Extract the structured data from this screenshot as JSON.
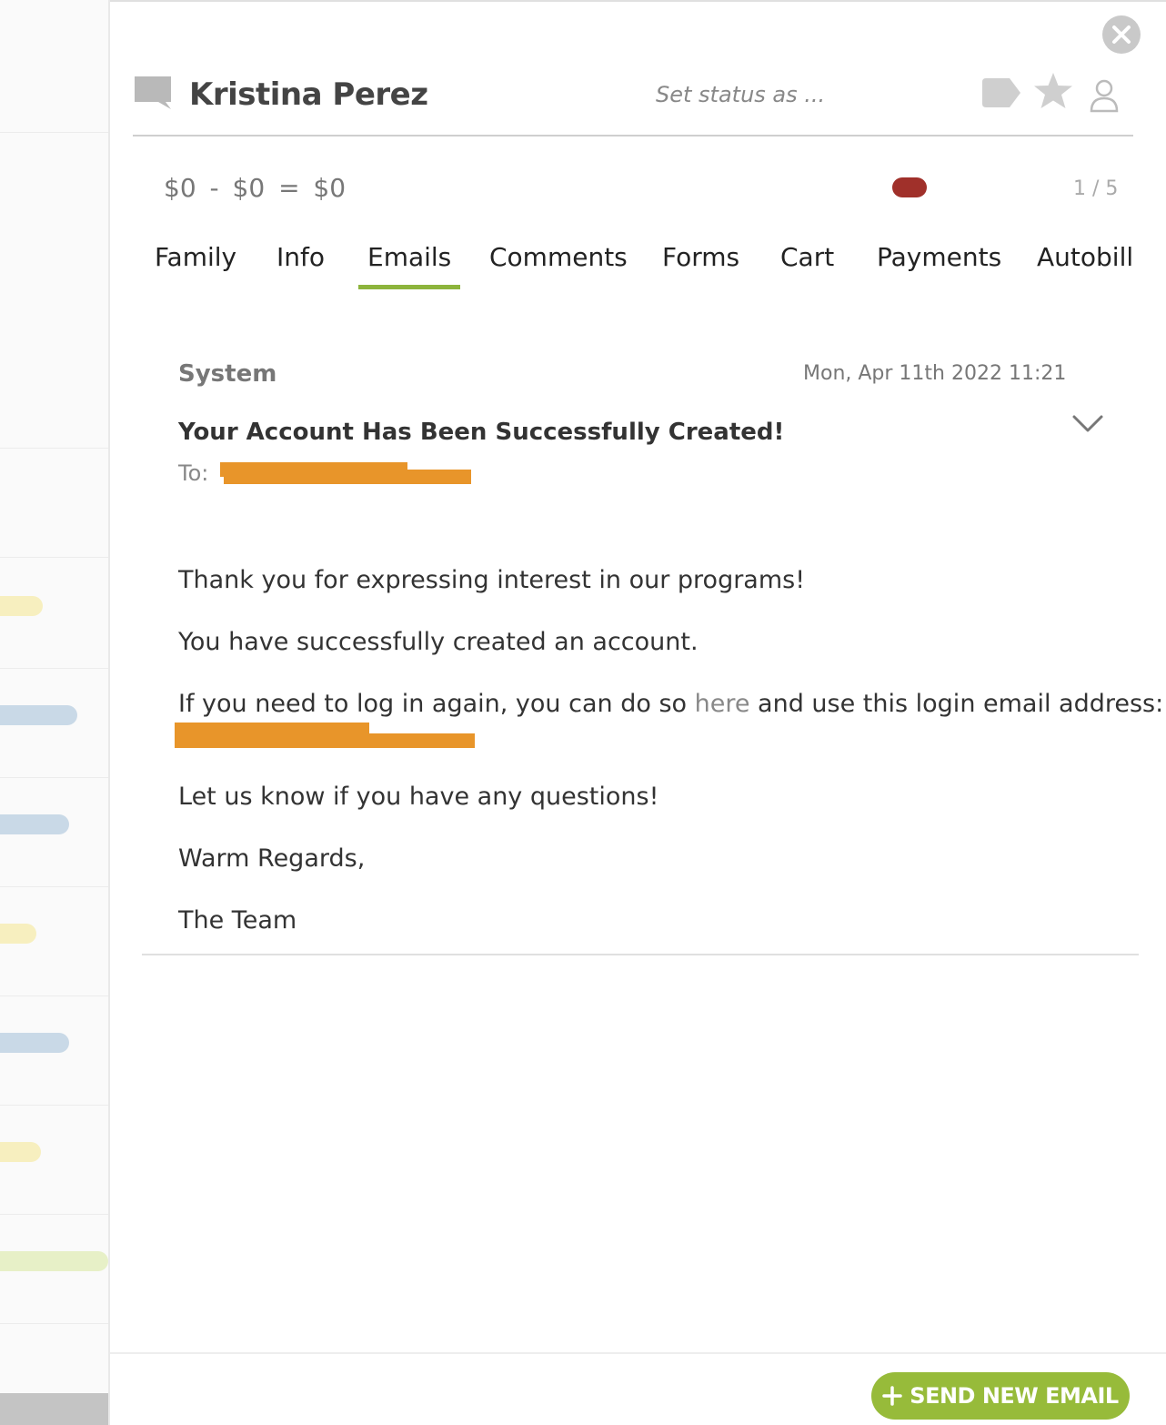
{
  "header": {
    "name": "Kristina Perez",
    "status_placeholder": "Set status as ..."
  },
  "balance": {
    "text": "$0 - $0 = $0"
  },
  "pager": "1 / 5",
  "tabs": [
    {
      "label": "Family"
    },
    {
      "label": "Info"
    },
    {
      "label": "Emails",
      "active": true
    },
    {
      "label": "Comments"
    },
    {
      "label": "Forms"
    },
    {
      "label": "Cart"
    },
    {
      "label": "Payments"
    },
    {
      "label": "Autobill"
    }
  ],
  "email": {
    "sender": "System",
    "date": "Mon, Apr 11th 2022 11:21",
    "subject": "Your Account Has Been Successfully Created!",
    "to_label": "To:",
    "body": {
      "line1": "Thank you for expressing interest in our programs!",
      "line2": "You have successfully created an account.",
      "line3_before": "If you need to log in again, you can do so ",
      "line3_link": "here",
      "line3_after": " and use this login email address:",
      "line4": "Let us know if you have any questions!",
      "line5": "Warm Regards,",
      "line6": "The Team"
    }
  },
  "footer": {
    "send_label": "SEND NEW EMAIL"
  },
  "colors": {
    "accent": "#97bb3a",
    "tab_underline": "#8db43c",
    "status_red": "#a0302a",
    "redaction": "#e8952a"
  },
  "icons": {
    "chat": "chat-bubble-icon",
    "tag": "tag-icon",
    "star": "star-icon",
    "user": "user-icon",
    "close": "close-icon",
    "chevron": "chevron-down-icon",
    "plus": "plus-icon"
  }
}
